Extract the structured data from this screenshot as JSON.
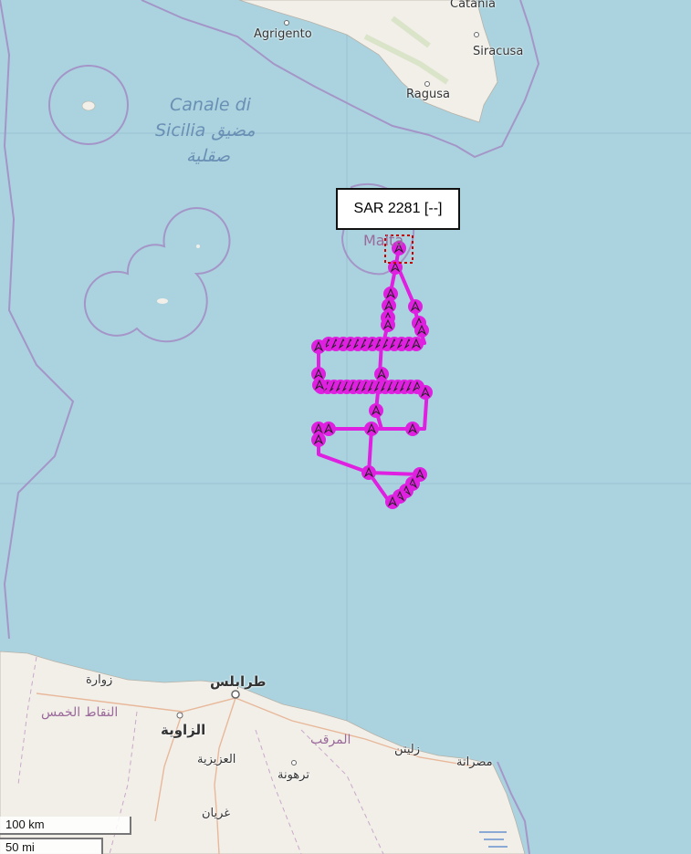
{
  "map": {
    "labels": {
      "catania": "Catania",
      "agrigento": "Agrigento",
      "siracusa": "Siracusa",
      "ragusa": "Ragusa",
      "canale_line1": "Canale di",
      "canale_line2": "Sicilia مضيق",
      "canale_line3": "صقلية",
      "malta": "Malta",
      "zuwara": "زوارة",
      "tripoli": "طرابلس",
      "nuqat": "النقاط الخمس",
      "zawiya": "الزاوية",
      "aziziya": "العزيزية",
      "tarhuna": "ترهونة",
      "murqub": "المرقب",
      "zliten": "زليتن",
      "misrata": "مصراتة",
      "gharyan": "غريان"
    },
    "tooltip": "SAR 2281 [--]",
    "scale": {
      "km": "100 km",
      "mi": "50 mi"
    },
    "colors": {
      "sea": "#aad3df",
      "land": "#f2efe9",
      "track": "#e020e0",
      "border": "#a48bc4"
    }
  }
}
